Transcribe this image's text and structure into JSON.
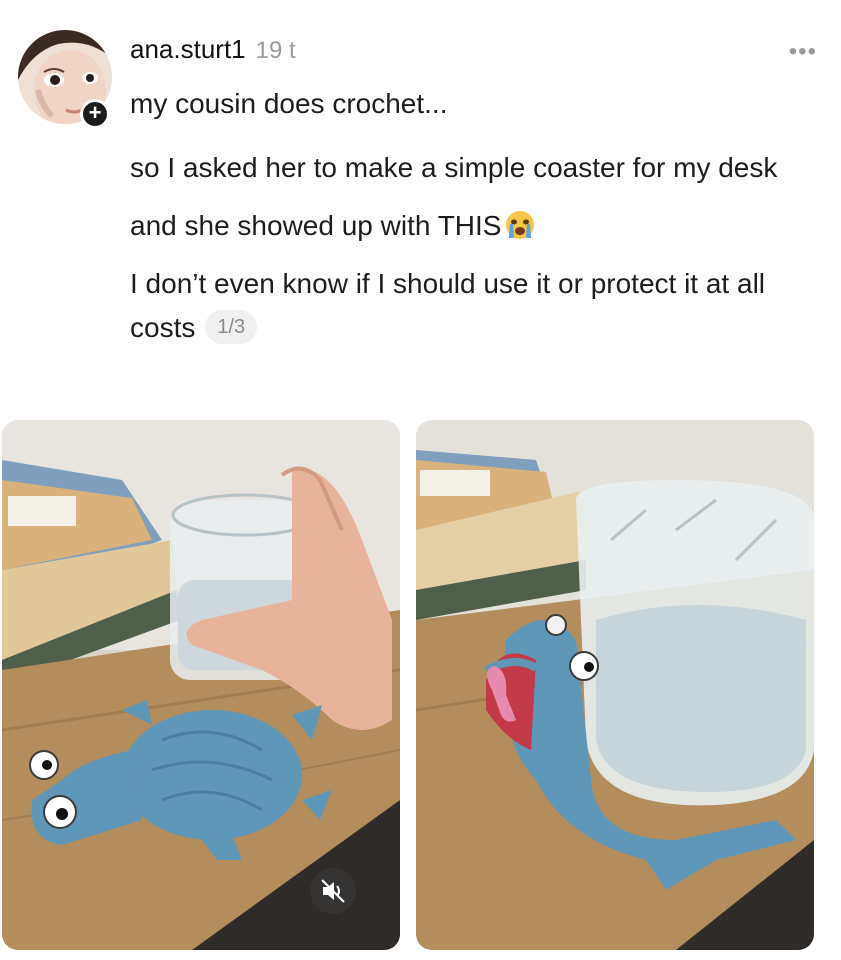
{
  "post": {
    "username": "ana.sturt1",
    "timestamp": "19 t",
    "more_icon": "•••",
    "follow_symbol": "+",
    "lines": [
      "my cousin does crochet...",
      "so I asked her to make a simple coaster for my desk",
      "and she showed up with THIS",
      "I don’t even know if I should use it or protect it at all costs"
    ],
    "emoji": "crying-face-emoji",
    "page_indicator": "1/3"
  },
  "media": {
    "items": [
      "crochet-frog-coaster-with-glass-photo",
      "frog-coaster-holding-glass-photo"
    ],
    "mute_icon": "speaker-muted-icon"
  },
  "colors": {
    "text": "#1d1d1d",
    "muted": "#9a9a9a",
    "crochet_blue": "#5f97b8",
    "desk_wood": "#b48d5c"
  }
}
